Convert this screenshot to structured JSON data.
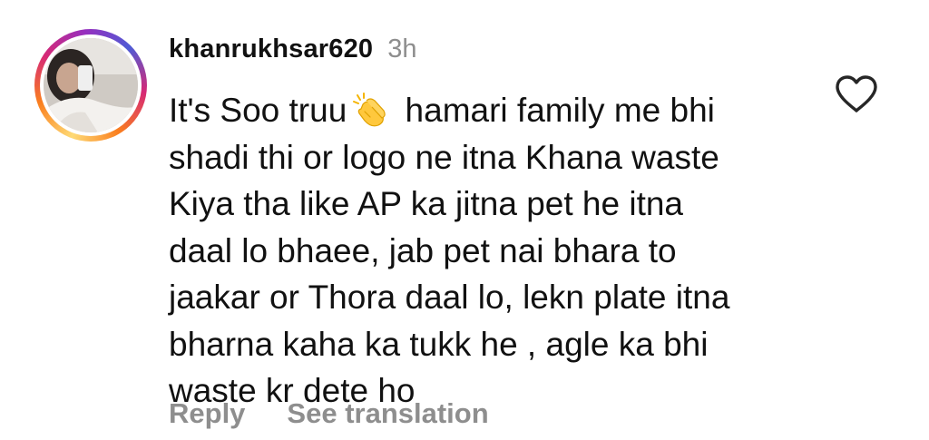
{
  "comment": {
    "username": "khanrukhsar620",
    "timestamp": "3h",
    "text_before_emoji": "It's Soo truu",
    "emoji": "clapping-hands-emoji",
    "text_after_emoji": " hamari family me bhi\nshadi thi or logo ne itna Khana waste\nKiya tha like AP ka jitna pet he itna\ndaal lo bhaee, jab pet nai bhara to\njaakar or Thora daal lo, lekn plate itna\nbharna kaha ka tukk he , agle ka bhi\nwaste kr dete ho"
  },
  "actions": {
    "reply_label": "Reply",
    "see_translation_label": "See translation"
  },
  "icons": {
    "like": "heart-outline-icon"
  },
  "colors": {
    "text": "#111111",
    "muted": "#8e8e8e",
    "background": "#ffffff"
  }
}
